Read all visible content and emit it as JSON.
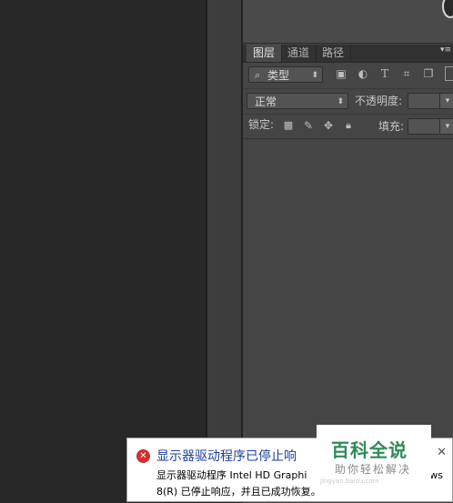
{
  "panel": {
    "tabs": [
      {
        "label": "图层",
        "active": true
      },
      {
        "label": "通道",
        "active": false
      },
      {
        "label": "路径",
        "active": false
      }
    ],
    "menu_glyph": "▾≡",
    "filter_kind": "类型",
    "blend_mode": "正常",
    "opacity_label": "不透明度:",
    "opacity_value": "",
    "lock_label": "锁定:",
    "fill_label": "填充:",
    "fill_value": "",
    "filter_icons": [
      "image-filter-icon",
      "adjustment-filter-icon",
      "type-filter-icon",
      "shape-filter-icon",
      "smart-object-filter-icon"
    ],
    "lock_icons": [
      "lock-transparent-icon",
      "lock-paint-icon",
      "lock-position-icon",
      "lock-all-icon"
    ]
  },
  "notification": {
    "title": "显示器驱动程序已停止响",
    "body_line1": "显示器驱动程序 Intel HD Graphi",
    "body_line2": "8(R) 已停止响应，并且已成功恢复。",
    "tail": "ws",
    "close": "✕"
  },
  "watermark": {
    "main": "百科全说",
    "sub": "助你轻松解决",
    "url": "jingyan.baidu.com"
  },
  "colors": {
    "panel_bg": "#454545",
    "canvas_bg": "#282828",
    "error_red": "#d22f2f",
    "title_blue": "#1f3f9f",
    "watermark_green": "#2e8b57"
  }
}
